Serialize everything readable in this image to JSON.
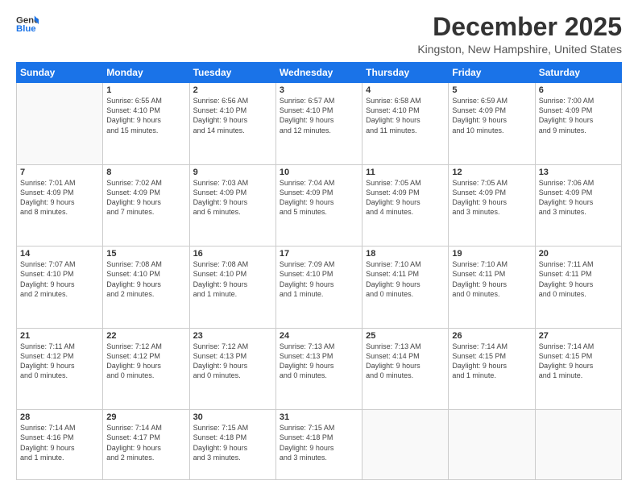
{
  "logo": {
    "line1": "General",
    "line2": "Blue"
  },
  "header": {
    "title": "December 2025",
    "location": "Kingston, New Hampshire, United States"
  },
  "weekdays": [
    "Sunday",
    "Monday",
    "Tuesday",
    "Wednesday",
    "Thursday",
    "Friday",
    "Saturday"
  ],
  "weeks": [
    [
      {
        "day": "",
        "info": ""
      },
      {
        "day": "1",
        "info": "Sunrise: 6:55 AM\nSunset: 4:10 PM\nDaylight: 9 hours\nand 15 minutes."
      },
      {
        "day": "2",
        "info": "Sunrise: 6:56 AM\nSunset: 4:10 PM\nDaylight: 9 hours\nand 14 minutes."
      },
      {
        "day": "3",
        "info": "Sunrise: 6:57 AM\nSunset: 4:10 PM\nDaylight: 9 hours\nand 12 minutes."
      },
      {
        "day": "4",
        "info": "Sunrise: 6:58 AM\nSunset: 4:10 PM\nDaylight: 9 hours\nand 11 minutes."
      },
      {
        "day": "5",
        "info": "Sunrise: 6:59 AM\nSunset: 4:09 PM\nDaylight: 9 hours\nand 10 minutes."
      },
      {
        "day": "6",
        "info": "Sunrise: 7:00 AM\nSunset: 4:09 PM\nDaylight: 9 hours\nand 9 minutes."
      }
    ],
    [
      {
        "day": "7",
        "info": "Sunrise: 7:01 AM\nSunset: 4:09 PM\nDaylight: 9 hours\nand 8 minutes."
      },
      {
        "day": "8",
        "info": "Sunrise: 7:02 AM\nSunset: 4:09 PM\nDaylight: 9 hours\nand 7 minutes."
      },
      {
        "day": "9",
        "info": "Sunrise: 7:03 AM\nSunset: 4:09 PM\nDaylight: 9 hours\nand 6 minutes."
      },
      {
        "day": "10",
        "info": "Sunrise: 7:04 AM\nSunset: 4:09 PM\nDaylight: 9 hours\nand 5 minutes."
      },
      {
        "day": "11",
        "info": "Sunrise: 7:05 AM\nSunset: 4:09 PM\nDaylight: 9 hours\nand 4 minutes."
      },
      {
        "day": "12",
        "info": "Sunrise: 7:05 AM\nSunset: 4:09 PM\nDaylight: 9 hours\nand 3 minutes."
      },
      {
        "day": "13",
        "info": "Sunrise: 7:06 AM\nSunset: 4:09 PM\nDaylight: 9 hours\nand 3 minutes."
      }
    ],
    [
      {
        "day": "14",
        "info": "Sunrise: 7:07 AM\nSunset: 4:10 PM\nDaylight: 9 hours\nand 2 minutes."
      },
      {
        "day": "15",
        "info": "Sunrise: 7:08 AM\nSunset: 4:10 PM\nDaylight: 9 hours\nand 2 minutes."
      },
      {
        "day": "16",
        "info": "Sunrise: 7:08 AM\nSunset: 4:10 PM\nDaylight: 9 hours\nand 1 minute."
      },
      {
        "day": "17",
        "info": "Sunrise: 7:09 AM\nSunset: 4:10 PM\nDaylight: 9 hours\nand 1 minute."
      },
      {
        "day": "18",
        "info": "Sunrise: 7:10 AM\nSunset: 4:11 PM\nDaylight: 9 hours\nand 0 minutes."
      },
      {
        "day": "19",
        "info": "Sunrise: 7:10 AM\nSunset: 4:11 PM\nDaylight: 9 hours\nand 0 minutes."
      },
      {
        "day": "20",
        "info": "Sunrise: 7:11 AM\nSunset: 4:11 PM\nDaylight: 9 hours\nand 0 minutes."
      }
    ],
    [
      {
        "day": "21",
        "info": "Sunrise: 7:11 AM\nSunset: 4:12 PM\nDaylight: 9 hours\nand 0 minutes."
      },
      {
        "day": "22",
        "info": "Sunrise: 7:12 AM\nSunset: 4:12 PM\nDaylight: 9 hours\nand 0 minutes."
      },
      {
        "day": "23",
        "info": "Sunrise: 7:12 AM\nSunset: 4:13 PM\nDaylight: 9 hours\nand 0 minutes."
      },
      {
        "day": "24",
        "info": "Sunrise: 7:13 AM\nSunset: 4:13 PM\nDaylight: 9 hours\nand 0 minutes."
      },
      {
        "day": "25",
        "info": "Sunrise: 7:13 AM\nSunset: 4:14 PM\nDaylight: 9 hours\nand 0 minutes."
      },
      {
        "day": "26",
        "info": "Sunrise: 7:14 AM\nSunset: 4:15 PM\nDaylight: 9 hours\nand 1 minute."
      },
      {
        "day": "27",
        "info": "Sunrise: 7:14 AM\nSunset: 4:15 PM\nDaylight: 9 hours\nand 1 minute."
      }
    ],
    [
      {
        "day": "28",
        "info": "Sunrise: 7:14 AM\nSunset: 4:16 PM\nDaylight: 9 hours\nand 1 minute."
      },
      {
        "day": "29",
        "info": "Sunrise: 7:14 AM\nSunset: 4:17 PM\nDaylight: 9 hours\nand 2 minutes."
      },
      {
        "day": "30",
        "info": "Sunrise: 7:15 AM\nSunset: 4:18 PM\nDaylight: 9 hours\nand 3 minutes."
      },
      {
        "day": "31",
        "info": "Sunrise: 7:15 AM\nSunset: 4:18 PM\nDaylight: 9 hours\nand 3 minutes."
      },
      {
        "day": "",
        "info": ""
      },
      {
        "day": "",
        "info": ""
      },
      {
        "day": "",
        "info": ""
      }
    ]
  ]
}
